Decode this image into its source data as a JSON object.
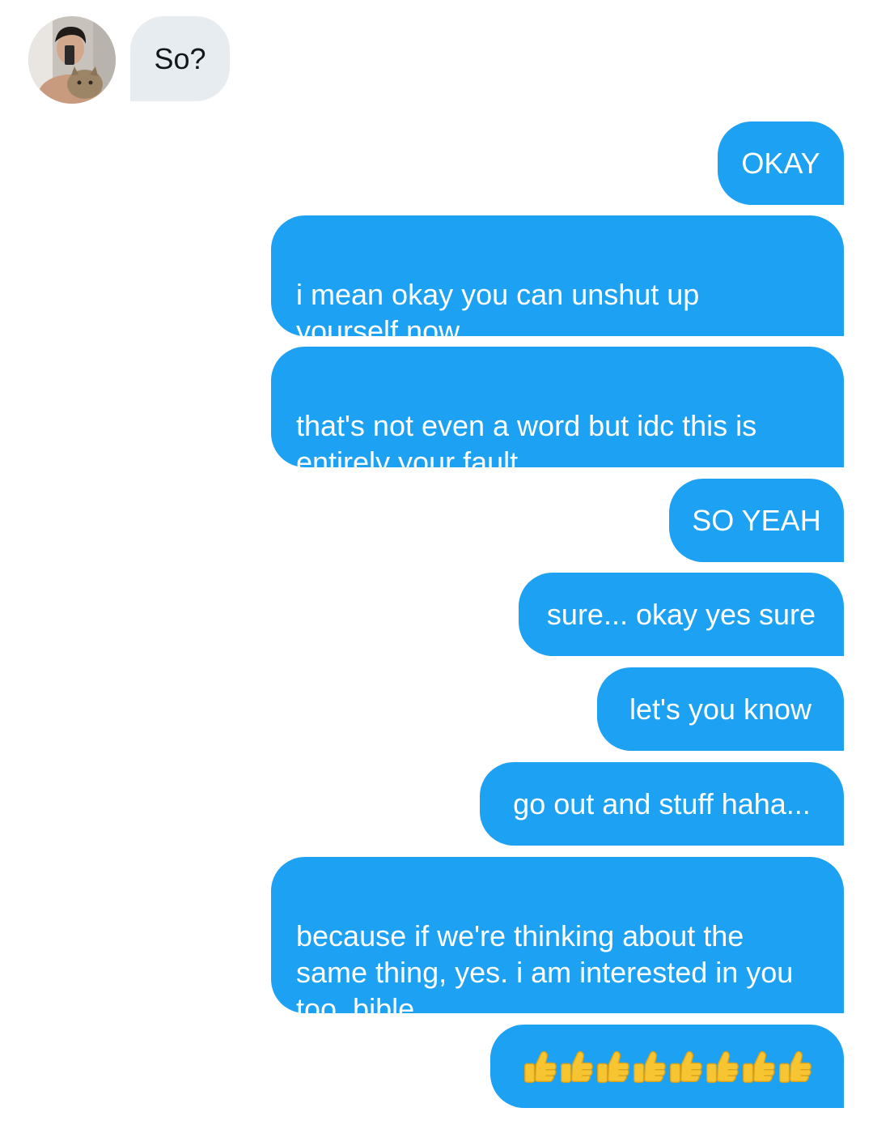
{
  "conversation": {
    "incoming": {
      "text": "So?",
      "avatar_icon": "profile-photo-person-with-cat"
    },
    "outgoing": [
      {
        "text": "OKAY"
      },
      {
        "text": "i mean okay you can unshut up\nyourself now"
      },
      {
        "text": "that's not even a word but idc this is\nentirely your fault"
      },
      {
        "text": "SO YEAH"
      },
      {
        "text": "sure... okay yes sure"
      },
      {
        "text": "let's you know"
      },
      {
        "text": "go out and stuff haha..."
      },
      {
        "text": "because if we're thinking about the\nsame thing, yes. i am interested in you\ntoo, bible."
      },
      {
        "emoji": "thumbs-up-icon",
        "count": 8
      }
    ]
  },
  "colors": {
    "outgoing_bubble": "#1da1f2",
    "incoming_bubble": "#e6ecf0",
    "outgoing_text": "#ffffff",
    "incoming_text": "#14171a",
    "thumbs_up": "#f7c531"
  }
}
